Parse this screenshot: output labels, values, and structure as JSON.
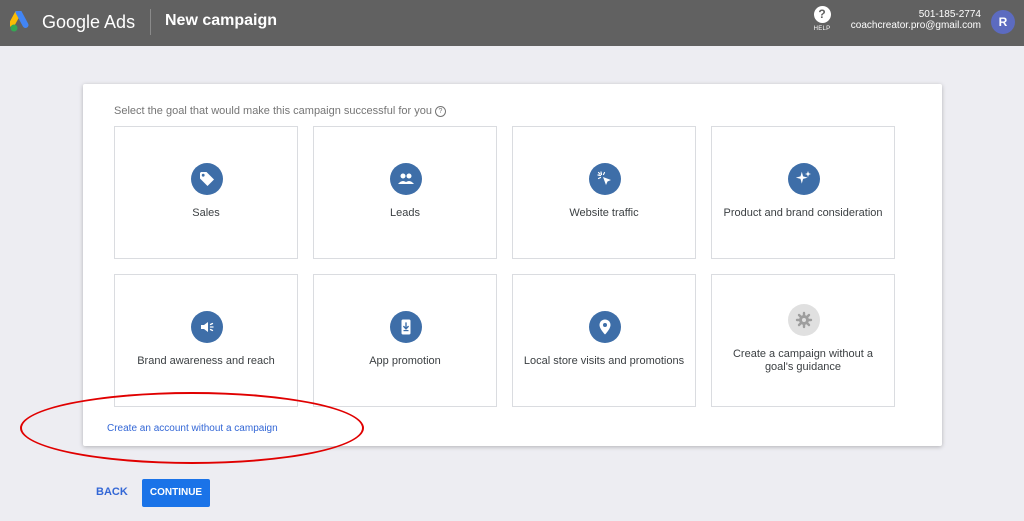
{
  "header": {
    "brand": "Google Ads",
    "title": "New campaign",
    "help_label": "HELP",
    "account_phone": "501-185-2774",
    "account_email": "coachcreator.pro@gmail.com",
    "avatar_initial": "R"
  },
  "main": {
    "prompt": "Select the goal that would make this campaign successful for you",
    "goals": [
      {
        "label": "Sales",
        "icon": "tag-icon"
      },
      {
        "label": "Leads",
        "icon": "people-icon"
      },
      {
        "label": "Website traffic",
        "icon": "cursor-click-icon"
      },
      {
        "label": "Product and brand consideration",
        "icon": "sparkle-icon"
      },
      {
        "label": "Brand awareness and reach",
        "icon": "megaphone-icon"
      },
      {
        "label": "App promotion",
        "icon": "phone-download-icon"
      },
      {
        "label": "Local store visits and promotions",
        "icon": "location-pin-icon"
      },
      {
        "label": "Create a campaign without a goal's guidance",
        "icon": "gear-icon"
      }
    ],
    "no_campaign_link": "Create an account without a campaign"
  },
  "footer": {
    "back_label": "BACK",
    "continue_label": "CONTINUE"
  },
  "colors": {
    "topbar": "#616161",
    "accent": "#1a73e8",
    "icon_circle": "#3e6ea8",
    "annotation": "#e00000"
  }
}
